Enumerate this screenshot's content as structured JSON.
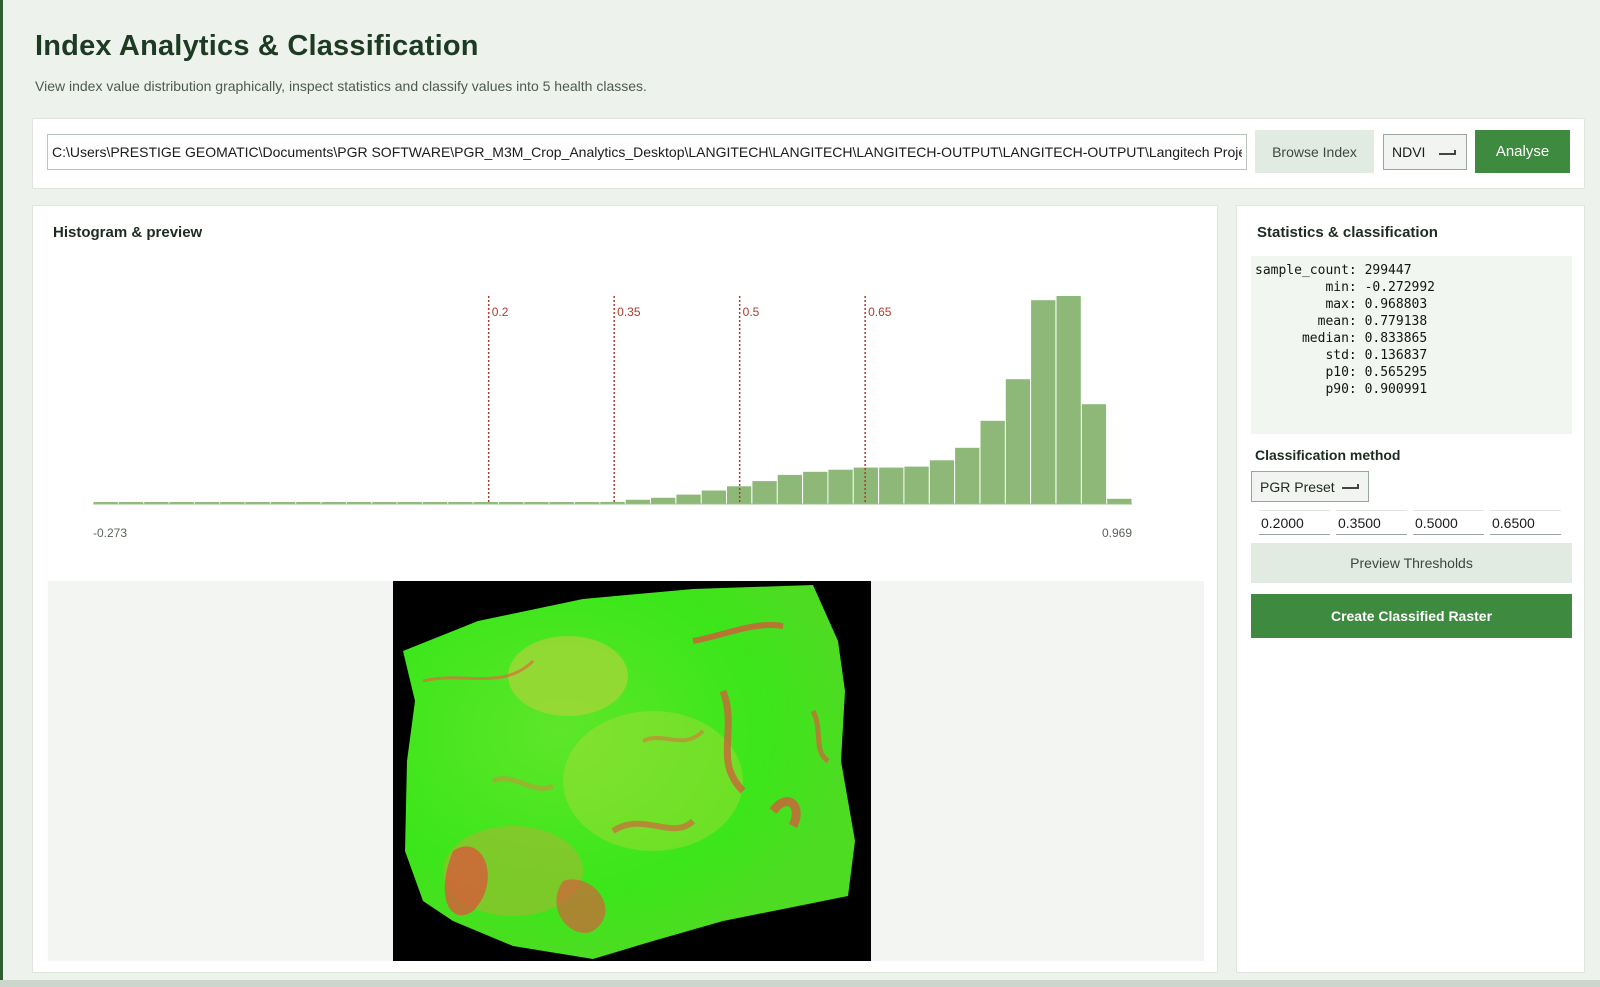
{
  "header": {
    "title": "Index Analytics & Classification",
    "subtitle": "View index value distribution graphically, inspect statistics and classify values into 5 health classes."
  },
  "toolbar": {
    "path_value": "C:\\Users\\PRESTIGE GEOMATIC\\Documents\\PGR SOFTWARE\\PGR_M3M_Crop_Analytics_Desktop\\LANGITECH\\LANGITECH\\LANGITECH-OUTPUT\\LANGITECH-OUTPUT\\Langitech Project",
    "browse_label": "Browse Index",
    "index_selected": "NDVI",
    "analyse_label": "Analyse"
  },
  "histogram_panel": {
    "title": "Histogram & preview"
  },
  "chart_data": {
    "type": "bar",
    "title": "",
    "xlim": [
      -0.273,
      0.969
    ],
    "x_tick_labels": [
      "-0.273",
      "0.969"
    ],
    "bins": 40,
    "bin_edges_start": -0.273,
    "bin_width": 0.03105,
    "values": [
      0.005,
      0.005,
      0.005,
      0.005,
      0.005,
      0.005,
      0.005,
      0.005,
      0.005,
      0.005,
      0.005,
      0.005,
      0.005,
      0.005,
      0.005,
      0.005,
      0.005,
      0.005,
      0.005,
      0.005,
      0.01,
      0.02,
      0.03,
      0.045,
      0.065,
      0.085,
      0.11,
      0.14,
      0.155,
      0.165,
      0.175,
      0.175,
      0.18,
      0.21,
      0.27,
      0.4,
      0.6,
      0.98,
      1.0,
      0.48,
      0.025
    ],
    "thresholds": [
      {
        "value": 0.2,
        "label": "0.2"
      },
      {
        "value": 0.35,
        "label": "0.35"
      },
      {
        "value": 0.5,
        "label": "0.5"
      },
      {
        "value": 0.65,
        "label": "0.65"
      }
    ],
    "bar_color": "#8db878",
    "threshold_color": "#b03a2e"
  },
  "stats_panel": {
    "title": "Statistics & classification",
    "stats": [
      {
        "key": "sample_count",
        "value": "299447"
      },
      {
        "key": "min",
        "value": "-0.272992"
      },
      {
        "key": "max",
        "value": "0.968803"
      },
      {
        "key": "mean",
        "value": "0.779138"
      },
      {
        "key": "median",
        "value": "0.833865"
      },
      {
        "key": "std",
        "value": "0.136837"
      },
      {
        "key": "p10",
        "value": "0.565295"
      },
      {
        "key": "p90",
        "value": "0.900991"
      }
    ],
    "method_label": "Classification method",
    "method_selected": "PGR Preset",
    "thresholds": [
      "0.2000",
      "0.3500",
      "0.5000",
      "0.6500"
    ],
    "preview_label": "Preview Thresholds",
    "create_label": "Create Classified Raster"
  },
  "colors": {
    "accent": "#3e8a3e",
    "secondary_button": "#e2ebe1",
    "background": "#edf2ec"
  }
}
